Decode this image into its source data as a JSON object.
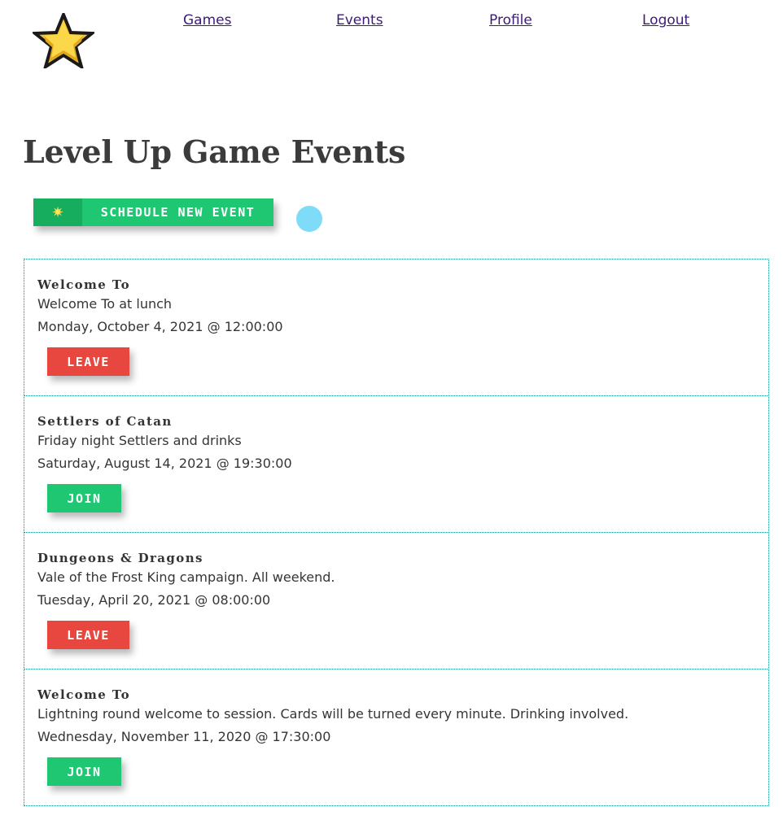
{
  "nav": {
    "games": "Games",
    "events": "Events",
    "profile": "Profile",
    "logout": "Logout"
  },
  "logo_icon": "pixel-star-icon",
  "page_title": "Level Up Game Events",
  "schedule_button": {
    "icon": "sparkle-star-icon",
    "label": "SCHEDULE NEW EVENT"
  },
  "colors": {
    "link": "#3c1a7a",
    "join": "#1fc773",
    "leave": "#e8473f",
    "card_border": "#138a8a",
    "cursor_dot": "#7fdcf8"
  },
  "events": [
    {
      "game": "Welcome To",
      "description": "Welcome To at lunch",
      "datetime": "Monday, October 4, 2021 @ 12:00:00",
      "action": "LEAVE",
      "action_type": "leave"
    },
    {
      "game": "Settlers of Catan",
      "description": "Friday night Settlers and drinks",
      "datetime": "Saturday, August 14, 2021 @ 19:30:00",
      "action": "JOIN",
      "action_type": "join"
    },
    {
      "game": "Dungeons & Dragons",
      "description": "Vale of the Frost King campaign. All weekend.",
      "datetime": "Tuesday, April 20, 2021 @ 08:00:00",
      "action": "LEAVE",
      "action_type": "leave"
    },
    {
      "game": "Welcome To",
      "description": "Lightning round welcome to session. Cards will be turned every minute. Drinking involved.",
      "datetime": "Wednesday, November 11, 2020 @ 17:30:00",
      "action": "JOIN",
      "action_type": "join"
    }
  ]
}
